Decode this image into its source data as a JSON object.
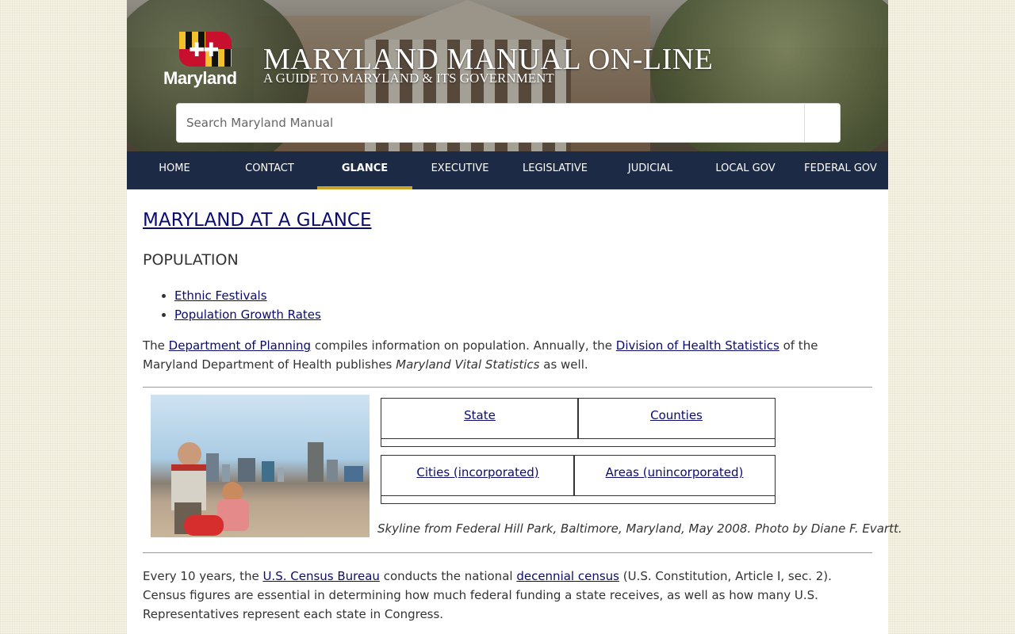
{
  "header": {
    "logo_text": "Maryland",
    "title": "MARYLAND MANUAL ON-LINE",
    "subtitle": "A GUIDE TO MARYLAND & ITS GOVERNMENT",
    "search_placeholder": "Search Maryland Manual"
  },
  "nav": [
    {
      "label": "HOME"
    },
    {
      "label": "CONTACT"
    },
    {
      "label": "GLANCE"
    },
    {
      "label": "EXECUTIVE"
    },
    {
      "label": "LEGISLATIVE"
    },
    {
      "label": "JUDICIAL"
    },
    {
      "label": "LOCAL GOV"
    },
    {
      "label": "FEDERAL GOV"
    }
  ],
  "nav_active": "GLANCE",
  "page": {
    "title": "MARYLAND AT A GLANCE",
    "section": "POPULATION",
    "links": [
      "Ethnic Festivals",
      "Population Growth Rates"
    ],
    "p1": {
      "t1": "The ",
      "link1": "Department of Planning",
      "t2": " compiles information on population. Annually, the ",
      "link2": "Division of Health Statistics",
      "t3": " of the Maryland Department of Health publishes ",
      "em": "Maryland Vital Statistics",
      "t4": " as well."
    },
    "table": {
      "row1": [
        "State",
        "Counties"
      ],
      "row2": [
        "Cities (incorporated)",
        "Areas (unincorporated)"
      ]
    },
    "caption": "Skyline from Federal Hill Park, Baltimore, Maryland, May 2008. Photo by Diane F. Evartt.",
    "p2": {
      "t1": "Every 10 years, the ",
      "link1": "U.S. Census Bureau",
      "t2": " conducts the national ",
      "link2": "decennial census",
      "t3": " (U.S. Constitution, Article I, sec. 2). Census figures are essential in determining how much federal funding a state receives, as well as how many U.S. Representatives represent each state in Congress."
    }
  },
  "colors": {
    "nav_bg": "#1d2a45",
    "nav_active_underline": "#c9a227",
    "link": "#0b0b6e"
  }
}
